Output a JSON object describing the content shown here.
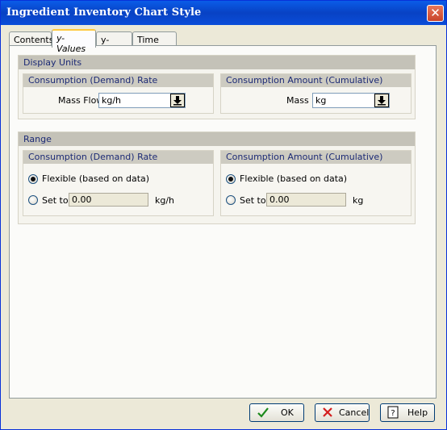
{
  "window": {
    "title": "Ingredient Inventory Chart Style"
  },
  "tabs": [
    {
      "label": "Contents"
    },
    {
      "label": "y-Values"
    },
    {
      "label": "y-Lines"
    },
    {
      "label": "Time Line"
    }
  ],
  "display_units": {
    "title": "Display Units",
    "rate": {
      "title": "Consumption (Demand) Rate",
      "field_label": "Mass Flow",
      "value": "kg/h"
    },
    "amount": {
      "title": "Consumption Amount (Cumulative)",
      "field_label": "Mass",
      "value": "kg"
    }
  },
  "range": {
    "title": "Range",
    "rate": {
      "title": "Consumption (Demand) Rate",
      "flexible_label": "Flexible (based on data)",
      "set_label": "Set to",
      "set_value": "0.00",
      "unit": "kg/h",
      "selected": "flexible"
    },
    "amount": {
      "title": "Consumption Amount (Cumulative)",
      "flexible_label": "Flexible (based on data)",
      "set_label": "Set to",
      "set_value": "0.00",
      "unit": "kg",
      "selected": "flexible"
    }
  },
  "buttons": {
    "ok": "OK",
    "cancel": "Cancel",
    "help": "Help"
  }
}
